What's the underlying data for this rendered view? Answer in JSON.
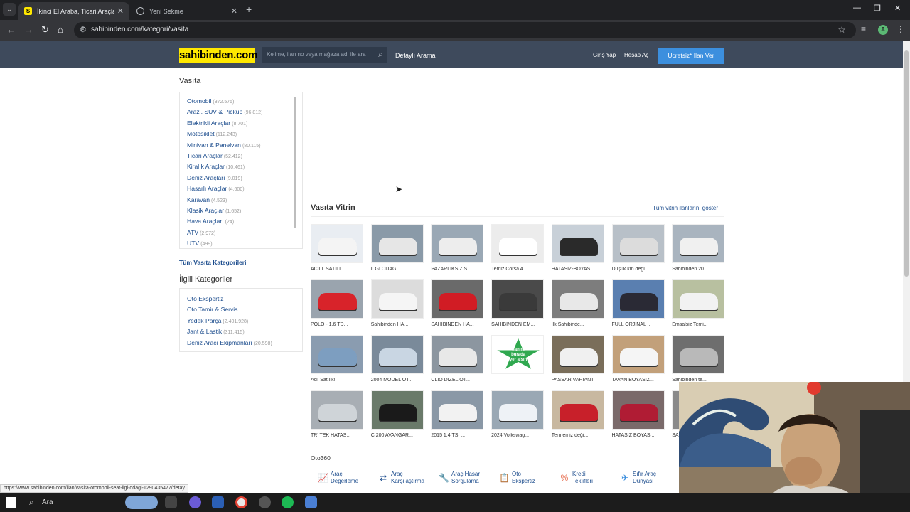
{
  "browser": {
    "tabs": [
      {
        "title": "İkinci El Araba, Ticari Araçlar, M",
        "active": true
      },
      {
        "title": "Yeni Sekme",
        "active": false
      }
    ],
    "url": "sahibinden.com/kategori/vasita",
    "status_url": "https://www.sahibinden.com/ilan/vasita-otomobil-seat-ilgi-odagi-1290435477/detay",
    "profile_initial": "A"
  },
  "header": {
    "logo": "sahibinden.com",
    "search_placeholder": "Kelime, ilan no veya mağaza adı ile ara",
    "detailed_search": "Detaylı Arama",
    "login": "Giriş Yap",
    "register": "Hesap Aç",
    "post_ad": "Ücretsiz* İlan Ver"
  },
  "sidebar": {
    "title": "Vasıta",
    "categories": [
      {
        "name": "Otomobil",
        "count": "(372.575)"
      },
      {
        "name": "Arazi, SUV & Pickup",
        "count": "(96.812)"
      },
      {
        "name": "Elektrikli Araçlar",
        "count": "(8.701)"
      },
      {
        "name": "Motosiklet",
        "count": "(112.243)"
      },
      {
        "name": "Minivan & Panelvan",
        "count": "(80.115)"
      },
      {
        "name": "Ticari Araçlar",
        "count": "(52.412)"
      },
      {
        "name": "Kiralık Araçlar",
        "count": "(10.461)"
      },
      {
        "name": "Deniz Araçları",
        "count": "(9.019)"
      },
      {
        "name": "Hasarlı Araçlar",
        "count": "(4.600)"
      },
      {
        "name": "Karavan",
        "count": "(4.523)"
      },
      {
        "name": "Klasik Araçlar",
        "count": "(1.652)"
      },
      {
        "name": "Hava Araçları",
        "count": "(24)"
      },
      {
        "name": "ATV",
        "count": "(2.972)"
      },
      {
        "name": "UTV",
        "count": "(499)"
      }
    ],
    "all_categories": "Tüm Vasıta Kategorileri",
    "related_title": "İlgili Kategoriler",
    "related": [
      {
        "name": "Oto Ekspertiz",
        "count": ""
      },
      {
        "name": "Oto Tamir & Servis",
        "count": ""
      },
      {
        "name": "Yedek Parça",
        "count": "(2.401.928)"
      },
      {
        "name": "Jant & Lastik",
        "count": "(311.415)"
      },
      {
        "name": "Deniz Aracı Ekipmanları",
        "count": "(20.598)"
      }
    ]
  },
  "vitrin": {
    "title": "Vasıta Vitrin",
    "show_all": "Tüm vitrin ilanlarını göster",
    "items": [
      {
        "caption": "ACİLL SATILI...",
        "color": "#e9edf2",
        "car": "#f4f4f4"
      },
      {
        "caption": "İLGİ ODAĞI",
        "color": "#8a9aa8",
        "car": "#e6e6e6"
      },
      {
        "caption": "PAZARLIKSIZ S...",
        "color": "#9aa8b5",
        "car": "#ededed"
      },
      {
        "caption": "Temiz Corsa 4...",
        "color": "#ececec",
        "car": "#ffffff"
      },
      {
        "caption": "HATASIZ-BOYAS...",
        "color": "#c8d0d8",
        "car": "#2a2a2a"
      },
      {
        "caption": "Düşük km deği...",
        "color": "#b8c0c8",
        "car": "#dcdcdc"
      },
      {
        "caption": "Sahibinden 20...",
        "color": "#a9b4bf",
        "car": "#f0f0f0"
      },
      {
        "caption": "POLO - 1.6 TD...",
        "color": "#9aa4ae",
        "car": "#d8232a"
      },
      {
        "caption": "Sahibinden HA...",
        "color": "#dcdcdc",
        "car": "#f5f5f5"
      },
      {
        "caption": "SAHİBİNDEN HA...",
        "color": "#6a6a6a",
        "car": "#d11c24"
      },
      {
        "caption": "SAHİBİNDEN EM...",
        "color": "#4a4a4a",
        "car": "#3a3a3a"
      },
      {
        "caption": "İlk Sahibinde...",
        "color": "#7d7d7d",
        "car": "#e8e8e8"
      },
      {
        "caption": "FULL ORJİNAL ...",
        "color": "#5a7fb0",
        "car": "#2a2a35"
      },
      {
        "caption": "Emsalsiz Temi...",
        "color": "#b8c0a0",
        "car": "#f2f2f2"
      },
      {
        "caption": "Acil Satılık!",
        "color": "#8a9cb0",
        "car": "#7d9ec0"
      },
      {
        "caption": "2004 MODEL OT...",
        "color": "#7a8a9a",
        "car": "#c9d6e3"
      },
      {
        "caption": "CLİO DİZEL OT...",
        "color": "#8c96a0",
        "car": "#e8e8e8"
      },
      {
        "caption": "",
        "color": "#ffffff",
        "car": "#2fa84f"
      },
      {
        "caption": "PASSAR VARIANT",
        "color": "#7a6e5a",
        "car": "#f0f0f0"
      },
      {
        "caption": "TAVAN BOYASIZ...",
        "color": "#c2a07a",
        "car": "#f5f5f5"
      },
      {
        "caption": "Sahibinden te...",
        "color": "#6e6e6e",
        "car": "#b9b9b9"
      },
      {
        "caption": "TR' TEK HATAS...",
        "color": "#a8aeb4",
        "car": "#cfd4d8"
      },
      {
        "caption": "C 200 AVANGAR...",
        "color": "#6a7a6a",
        "car": "#1a1a1a"
      },
      {
        "caption": "2015 1.4 TSİ ...",
        "color": "#8a98a6",
        "car": "#f2f2f2"
      },
      {
        "caption": "2024 Volkswag...",
        "color": "#9aa8b4",
        "car": "#eef2f6"
      },
      {
        "caption": "Termemiz deği...",
        "color": "#c8b8a0",
        "car": "#c8202a"
      },
      {
        "caption": "HATASİZ BOYAS...",
        "color": "#7a6a6a",
        "car": "#b01c34"
      },
      {
        "caption": "SA...",
        "color": "#8a8a8a",
        "car": "#3a3a3a"
      }
    ],
    "promo_text": [
      "İlanım",
      "burada",
      "yer alsın"
    ]
  },
  "oto360": {
    "title": "Oto360",
    "services": [
      {
        "label": [
          "Araç",
          "Değerleme"
        ],
        "icon": "chart-icon",
        "color": "#2a9d8f"
      },
      {
        "label": [
          "Araç",
          "Karşılaştırma"
        ],
        "icon": "compare-icon",
        "color": "#1a4b8c"
      },
      {
        "label": [
          "Araç Hasar",
          "Sorgulama"
        ],
        "icon": "wrench-icon",
        "color": "#1a4b8c"
      },
      {
        "label": [
          "Oto",
          "Ekspertiz"
        ],
        "icon": "clipboard-icon",
        "color": "#2a9d8f"
      },
      {
        "label": [
          "Kredi",
          "Teklifleri"
        ],
        "icon": "percent-icon",
        "color": "#e76f51"
      },
      {
        "label": [
          "Sıfır Araç",
          "Dünyası"
        ],
        "icon": "plane-icon",
        "color": "#3c8fde"
      }
    ]
  },
  "taskbar": {
    "search_label": "Ara"
  }
}
